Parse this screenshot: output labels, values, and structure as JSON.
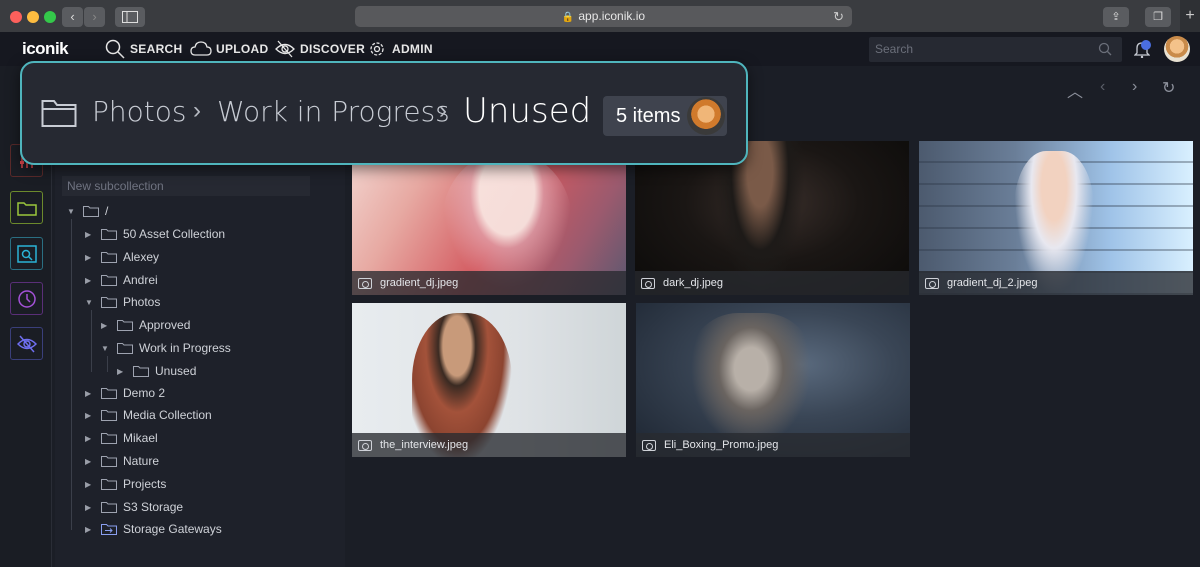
{
  "browser": {
    "url": "app.iconik.io"
  },
  "app": {
    "logo": "iconik"
  },
  "nav": [
    {
      "label": "SEARCH",
      "icon": "search-icon"
    },
    {
      "label": "UPLOAD",
      "icon": "cloud-upload-icon"
    },
    {
      "label": "DISCOVER",
      "icon": "discover-icon"
    },
    {
      "label": "ADMIN",
      "icon": "gear-icon"
    }
  ],
  "search": {
    "placeholder": "Search"
  },
  "tree": {
    "new_subcollection_placeholder": "New subcollection",
    "root": "/",
    "items": [
      {
        "label": "50 Asset Collection"
      },
      {
        "label": "Alexey"
      },
      {
        "label": "Andrei"
      },
      {
        "label": "Photos"
      },
      {
        "label": "Approved"
      },
      {
        "label": "Work in Progress"
      },
      {
        "label": "Unused"
      },
      {
        "label": "Demo 2"
      },
      {
        "label": "Media Collection"
      },
      {
        "label": "Mikael"
      },
      {
        "label": "Nature"
      },
      {
        "label": "Projects"
      },
      {
        "label": "S3 Storage"
      },
      {
        "label": "Storage Gateways"
      }
    ]
  },
  "breadcrumb": {
    "items": [
      "Photos",
      "Work in Progress",
      "Unused"
    ],
    "count": "5 items"
  },
  "assets": [
    {
      "name": "gradient_dj.jpeg"
    },
    {
      "name": "dark_dj.jpeg"
    },
    {
      "name": "gradient_dj_2.jpeg"
    },
    {
      "name": "the_interview.jpeg"
    },
    {
      "name": "Eli_Boxing_Promo.jpeg"
    }
  ],
  "colors": {
    "accent": "#4fb5bd",
    "background": "#1b1e26",
    "panel": "#1e212a"
  }
}
